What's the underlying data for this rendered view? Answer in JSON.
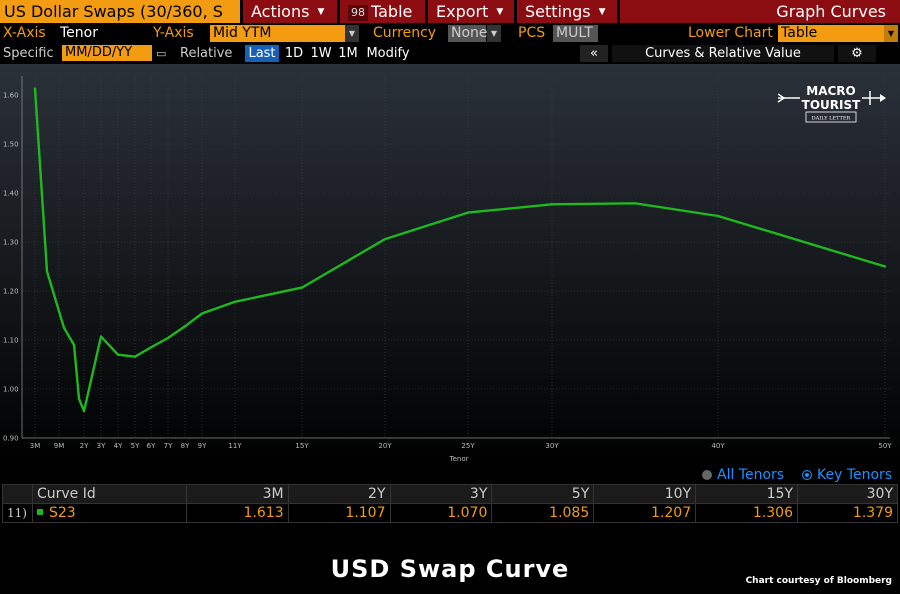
{
  "toolbar": {
    "title": "US Dollar Swaps (30/360, S",
    "actions_label": "Actions",
    "table_num": "98",
    "table_label": "Table",
    "export_label": "Export",
    "settings_label": "Settings",
    "graph_curves_label": "Graph Curves"
  },
  "controls": {
    "xaxis_label": "X-Axis",
    "xaxis_value": "Tenor",
    "yaxis_label": "Y-Axis",
    "yaxis_value": "Mid YTM",
    "currency_label": "Currency",
    "currency_value": "None",
    "pcs_label": "PCS",
    "pcs_value": "MULT",
    "lower_chart_label": "Lower Chart",
    "lower_chart_value": "Table",
    "specific_label": "Specific",
    "date_placeholder": "MM/DD/YY",
    "relative_label": "Relative",
    "range_buttons": [
      "Last",
      "1D",
      "1W",
      "1M"
    ],
    "modify_label": "Modify",
    "collapse_label": "«",
    "panel_label": "Curves & Relative Value"
  },
  "chart_data": {
    "type": "line",
    "xlabel": "Tenor",
    "ylabel": "",
    "ylim": [
      0.9,
      1.65
    ],
    "y_ticks": [
      "1.60",
      "1.50",
      "1.40",
      "1.30",
      "1.20",
      "1.10",
      "1.00",
      "0.90"
    ],
    "x_tick_labels": [
      "3M",
      "9M",
      "2Y",
      "3Y",
      "4Y",
      "5Y",
      "6Y",
      "7Y",
      "8Y",
      "9Y",
      "11Y",
      "15Y",
      "20Y",
      "25Y",
      "30Y",
      "40Y",
      "50Y"
    ],
    "x_tick_years": [
      0.25,
      0.75,
      2,
      3,
      4,
      5,
      6,
      7,
      8,
      9,
      11,
      15,
      20,
      25,
      30,
      40,
      50
    ],
    "series": [
      {
        "name": "S23",
        "color": "#1fb81f",
        "x": [
          0.25,
          0.5,
          1,
          1.5,
          1.75,
          2,
          3,
          4,
          5,
          6,
          7,
          8,
          9,
          11,
          15,
          20,
          25,
          30,
          35,
          40,
          50
        ],
        "y": [
          1.613,
          1.24,
          1.125,
          1.09,
          0.98,
          0.955,
          1.107,
          1.07,
          1.066,
          1.085,
          1.104,
          1.128,
          1.154,
          1.178,
          1.207,
          1.306,
          1.36,
          1.377,
          1.379,
          1.353,
          1.25
        ]
      }
    ]
  },
  "logo": {
    "line1": "MACRO",
    "line2": "TOURIST",
    "line3": "DAILY LETTER"
  },
  "tenor_toggle": {
    "all_label": "All Tenors",
    "key_label": "Key Tenors"
  },
  "table": {
    "headers": [
      "Curve Id",
      "3M",
      "2Y",
      "3Y",
      "5Y",
      "10Y",
      "15Y",
      "30Y"
    ],
    "rows": [
      {
        "index": "11)",
        "curve": "S23",
        "values": [
          "1.613",
          "1.107",
          "1.070",
          "1.085",
          "1.207",
          "1.306",
          "1.379"
        ]
      }
    ]
  },
  "caption": "USD Swap Curve",
  "courtesy": "Chart courtesy of Bloomberg"
}
